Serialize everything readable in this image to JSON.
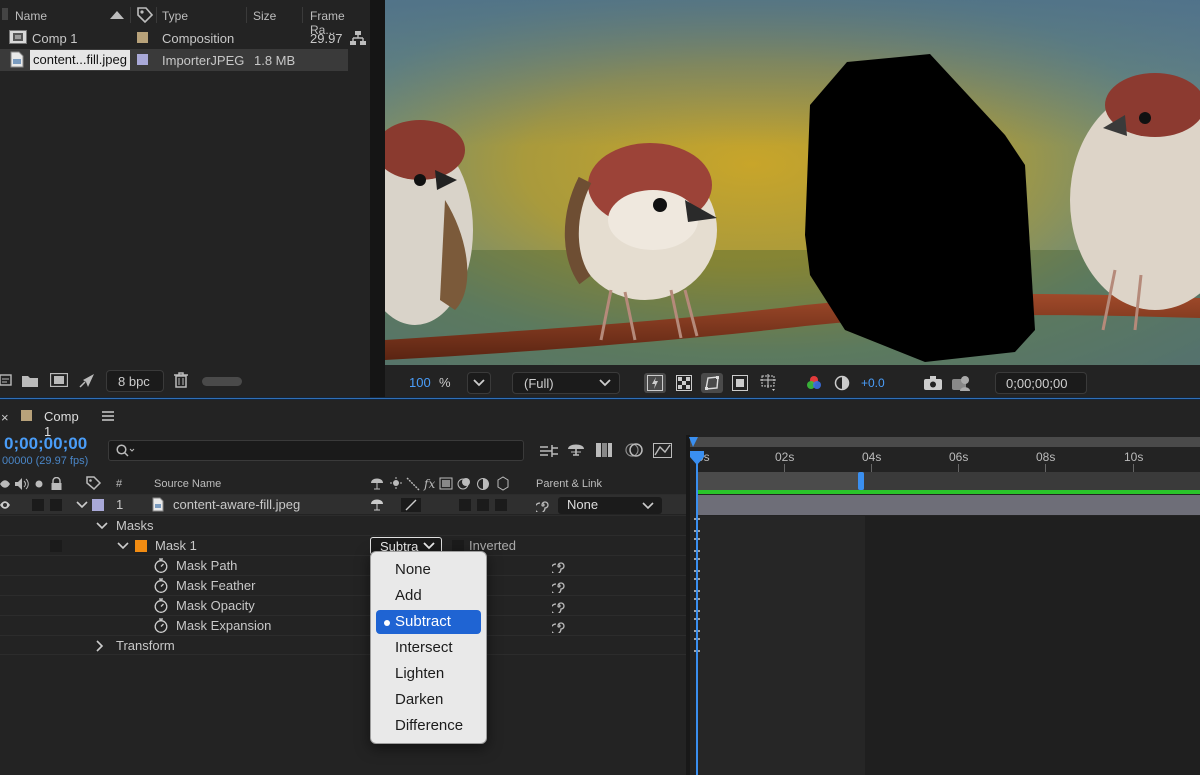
{
  "project": {
    "columns": {
      "name": "Name",
      "type": "Type",
      "size": "Size",
      "frame_rate": "Frame Ra..."
    },
    "items": [
      {
        "name": "Comp 1",
        "type": "Composition",
        "size": "",
        "frame_rate": "29.97",
        "label_color": "#b8a27a"
      },
      {
        "name": "content...fill.jpeg",
        "type": "ImporterJPEG",
        "size": "1.8 MB",
        "frame_rate": "",
        "label_color": "#a9a9d8"
      }
    ],
    "bpc": "8 bpc"
  },
  "viewer": {
    "zoom": "100",
    "zoom_unit": "%",
    "resolution": "(Full)",
    "exposure": "+0.0",
    "timecode": "0;00;00;00"
  },
  "timeline": {
    "tab_title": "Comp 1",
    "timecode": "0;00;00;00",
    "frames_fps": "00000 (29.97 fps)",
    "header": {
      "num": "#",
      "source_name": "Source Name",
      "parent_link": "Parent & Link"
    },
    "layer": {
      "index": "1",
      "name": "content-aware-fill.jpeg",
      "parent": "None"
    },
    "masks_label": "Masks",
    "mask1": {
      "name": "Mask 1",
      "mode": "Subtra",
      "inverted": "Inverted",
      "color": "#f28c12"
    },
    "properties": [
      "Mask Path",
      "Mask Feather",
      "Mask Opacity",
      "Mask Expansion"
    ],
    "transform_label": "Transform",
    "ruler": [
      "0s",
      "02s",
      "04s",
      "06s",
      "08s",
      "10s"
    ]
  },
  "menu": {
    "items": [
      "None",
      "Add",
      "Subtract",
      "Intersect",
      "Lighten",
      "Darken",
      "Difference"
    ],
    "selected": "Subtract"
  },
  "colors": {
    "accent": "#2f6fb8",
    "timecode_blue": "#4a9df8",
    "menu_selected": "#1f64d3",
    "green_bar": "#2ac42a"
  }
}
